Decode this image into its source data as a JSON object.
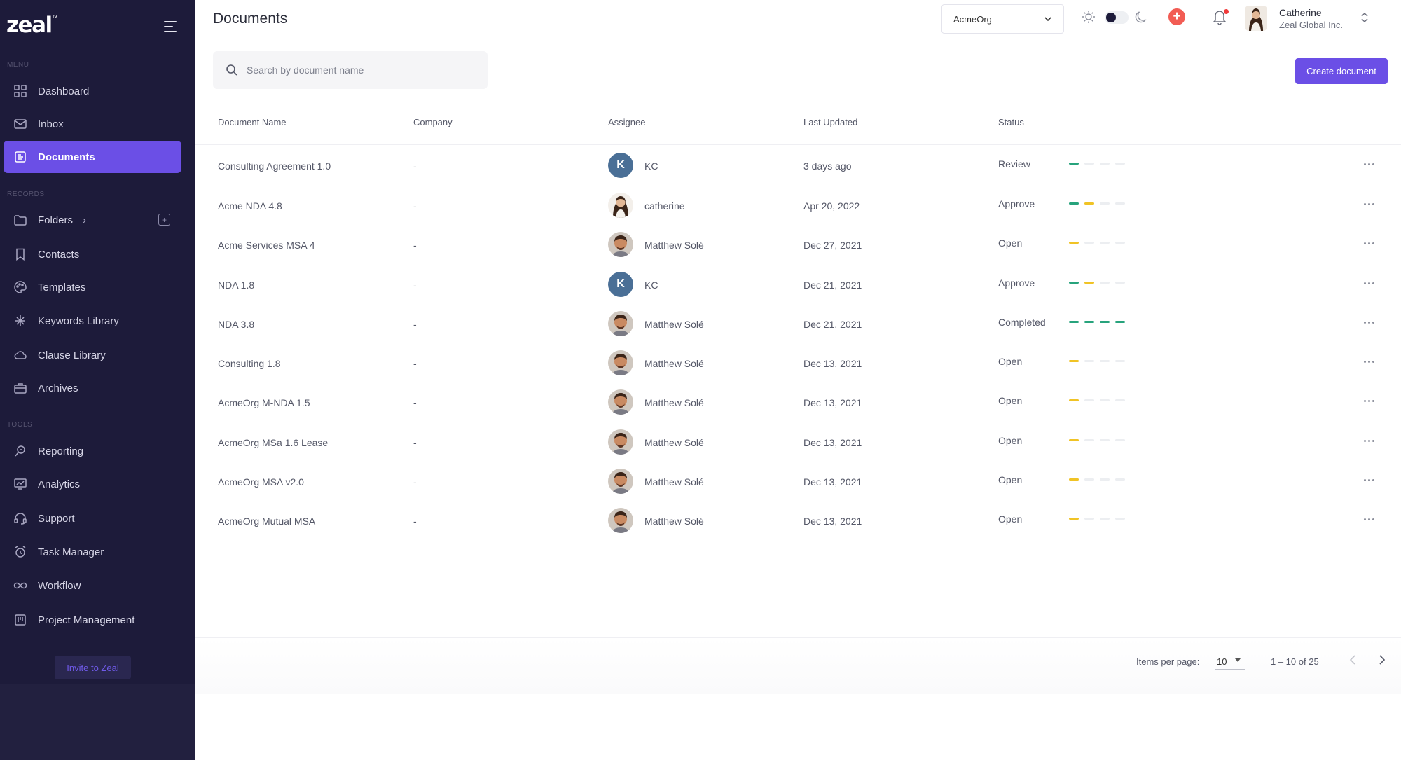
{
  "brand": {
    "name": "zeal",
    "tm": "™"
  },
  "sidebar": {
    "sections": {
      "menu": "MENU",
      "records": "RECORDS",
      "tools": "TOOLS"
    },
    "items": [
      {
        "label": "Dashboard",
        "icon": "grid-icon"
      },
      {
        "label": "Inbox",
        "icon": "mail-icon"
      },
      {
        "label": "Documents",
        "icon": "document-icon",
        "active": true
      },
      {
        "label": "Folders",
        "icon": "folder-icon"
      },
      {
        "label": "Contacts",
        "icon": "bookmark-icon"
      },
      {
        "label": "Templates",
        "icon": "palette-icon"
      },
      {
        "label": "Keywords Library",
        "icon": "keyword-icon"
      },
      {
        "label": "Clause Library",
        "icon": "cloud-icon"
      },
      {
        "label": "Archives",
        "icon": "briefcase-icon"
      },
      {
        "label": "Reporting",
        "icon": "reporting-icon"
      },
      {
        "label": "Analytics",
        "icon": "analytics-icon"
      },
      {
        "label": "Support",
        "icon": "headset-icon"
      },
      {
        "label": "Task Manager",
        "icon": "alarm-icon"
      },
      {
        "label": "Workflow",
        "icon": "infinity-icon"
      },
      {
        "label": "Project Management",
        "icon": "kanban-icon"
      }
    ],
    "invite_label": "Invite to Zeal"
  },
  "header": {
    "title": "Documents",
    "org": "AcmeOrg",
    "user": {
      "name": "Catherine",
      "company": "Zeal Global Inc."
    },
    "add_symbol": "+"
  },
  "search": {
    "placeholder": "Search by document name"
  },
  "create_label": "Create document",
  "table": {
    "columns": [
      "Document Name",
      "Company",
      "Assignee",
      "Last Updated",
      "Status"
    ],
    "rows": [
      {
        "name": "Consulting Agreement 1.0",
        "company": "-",
        "assignee": "KC",
        "initial": "K",
        "avatar": "initial",
        "updated": "3 days ago",
        "status": "Review",
        "progress": [
          "green",
          "off",
          "off",
          "off"
        ]
      },
      {
        "name": "Acme NDA 4.8",
        "company": "-",
        "assignee": "catherine",
        "initial": "",
        "avatar": "woman",
        "updated": "Apr 20, 2022",
        "status": "Approve",
        "progress": [
          "green",
          "yellow",
          "off",
          "off"
        ]
      },
      {
        "name": "Acme Services MSA 4",
        "company": "-",
        "assignee": "Matthew Solé",
        "initial": "",
        "avatar": "man",
        "updated": "Dec 27, 2021",
        "status": "Open",
        "progress": [
          "yellow",
          "off",
          "off",
          "off"
        ]
      },
      {
        "name": "NDA 1.8",
        "company": "-",
        "assignee": "KC",
        "initial": "K",
        "avatar": "initial",
        "updated": "Dec 21, 2021",
        "status": "Approve",
        "progress": [
          "green",
          "yellow",
          "off",
          "off"
        ]
      },
      {
        "name": "NDA 3.8",
        "company": "-",
        "assignee": "Matthew Solé",
        "initial": "",
        "avatar": "man",
        "updated": "Dec 21, 2021",
        "status": "Completed",
        "progress": [
          "green",
          "green",
          "green",
          "green"
        ]
      },
      {
        "name": "Consulting 1.8",
        "company": "-",
        "assignee": "Matthew Solé",
        "initial": "",
        "avatar": "man",
        "updated": "Dec 13, 2021",
        "status": "Open",
        "progress": [
          "yellow",
          "off",
          "off",
          "off"
        ]
      },
      {
        "name": "AcmeOrg M-NDA 1.5",
        "company": "-",
        "assignee": "Matthew Solé",
        "initial": "",
        "avatar": "man",
        "updated": "Dec 13, 2021",
        "status": "Open",
        "progress": [
          "yellow",
          "off",
          "off",
          "off"
        ]
      },
      {
        "name": "AcmeOrg MSa 1.6 Lease",
        "company": "-",
        "assignee": "Matthew Solé",
        "initial": "",
        "avatar": "man",
        "updated": "Dec 13, 2021",
        "status": "Open",
        "progress": [
          "yellow",
          "off",
          "off",
          "off"
        ]
      },
      {
        "name": "AcmeOrg MSA v2.0",
        "company": "-",
        "assignee": "Matthew Solé",
        "initial": "",
        "avatar": "man",
        "updated": "Dec 13, 2021",
        "status": "Open",
        "progress": [
          "yellow",
          "off",
          "off",
          "off"
        ]
      },
      {
        "name": "AcmeOrg Mutual MSA",
        "company": "-",
        "assignee": "Matthew Solé",
        "initial": "",
        "avatar": "man",
        "updated": "Dec 13, 2021",
        "status": "Open",
        "progress": [
          "yellow",
          "off",
          "off",
          "off"
        ]
      }
    ]
  },
  "pagination": {
    "items_per_page_label": "Items per page:",
    "items_per_page": "10",
    "range": "1 – 10 of 25"
  },
  "colors": {
    "accent": "#6b4fe6",
    "sidebar": "#1d1b3a",
    "green": "#27a37c",
    "yellow": "#f0c325",
    "red": "#f25c54"
  }
}
